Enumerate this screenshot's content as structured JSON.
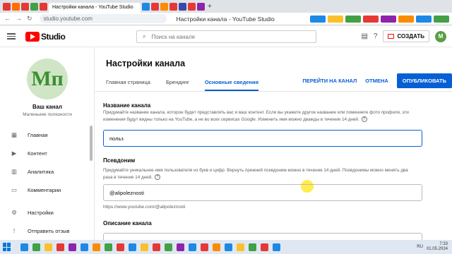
{
  "browser": {
    "active_tab_title": "Настройки канала - YouTube Studio",
    "address": "studio.youtube.com",
    "page_title_in_bar": "Настройки канала - YouTube Studio",
    "new_tab": "+",
    "tab_colors": [
      "#e53935",
      "#ff6d00",
      "#e53935",
      "#43a047",
      "#e53935",
      "#1e88e5",
      "#e53935",
      "#fb8c00",
      "#e53935",
      "#3949ab",
      "#e53935",
      "#8e24aa"
    ],
    "ext_colors": [
      "#1e88e5",
      "#fbc02d",
      "#43a047",
      "#e53935",
      "#8e24aa",
      "#fb8c00",
      "#1e88e5",
      "#43a047"
    ]
  },
  "studio": {
    "logo_text": "Studio",
    "search_placeholder": "Поиск на канале",
    "create_label": "СОЗДАТЬ",
    "avatar_letter": "М"
  },
  "sidebar": {
    "avatar_text": "Мп",
    "channel_name": "Ваш канал",
    "channel_handle": "Маленькие полезности",
    "items": [
      {
        "label": "Главная",
        "icon": "▦"
      },
      {
        "label": "Контент",
        "icon": "▶"
      },
      {
        "label": "Аналитика",
        "icon": "▥"
      },
      {
        "label": "Комментарии",
        "icon": "▭"
      }
    ],
    "bottom_items": [
      {
        "label": "Настройки",
        "icon": "⚙"
      },
      {
        "label": "Отправить отзыв",
        "icon": "!"
      }
    ]
  },
  "main": {
    "title": "Настройки канала",
    "tabs": [
      "Главная страница",
      "Брендинг",
      "Основные сведения"
    ],
    "cancel_links": [
      "ПЕРЕЙТИ НА КАНАЛ",
      "ОТМЕНА"
    ],
    "publish": "ОПУБЛИКОВАТЬ",
    "name_section": {
      "label": "Название канала",
      "description": "Придумайте название канала, которое будет представлять вас и ваш контент. Если вы укажете другое название или поменяете фото профиля, эти изменения будут видны только на YouTube, а не во всех сервисах Google. Изменить имя можно дважды в течение 14 дней.",
      "value": "польз"
    },
    "handle_section": {
      "label": "Псевдоним",
      "description": "Придумайте уникальное имя пользователя из букв и цифр. Вернуть прежний псевдоним можно в течение 14 дней. Псевдонимы можно менять два раза в течение 14 дней.",
      "value": "@alipoleznosti",
      "url": "https://www.youtube.com/@alipoleznosti"
    },
    "description_section": {
      "label": "Описание канала"
    }
  },
  "taskbar": {
    "icon_colors": [
      "#1e88e5",
      "#43a047",
      "#fbc02d",
      "#e53935",
      "#8e24aa",
      "#1e88e5",
      "#fb8c00",
      "#43a047",
      "#e53935",
      "#1e88e5",
      "#fbc02d",
      "#e53935",
      "#43a047",
      "#8e24aa",
      "#1e88e5",
      "#e53935",
      "#fb8c00",
      "#1e88e5",
      "#fbc02d",
      "#43a047",
      "#e53935",
      "#1e88e5"
    ],
    "lang": "RU",
    "time": "7:33",
    "date": "01.05.2024"
  }
}
